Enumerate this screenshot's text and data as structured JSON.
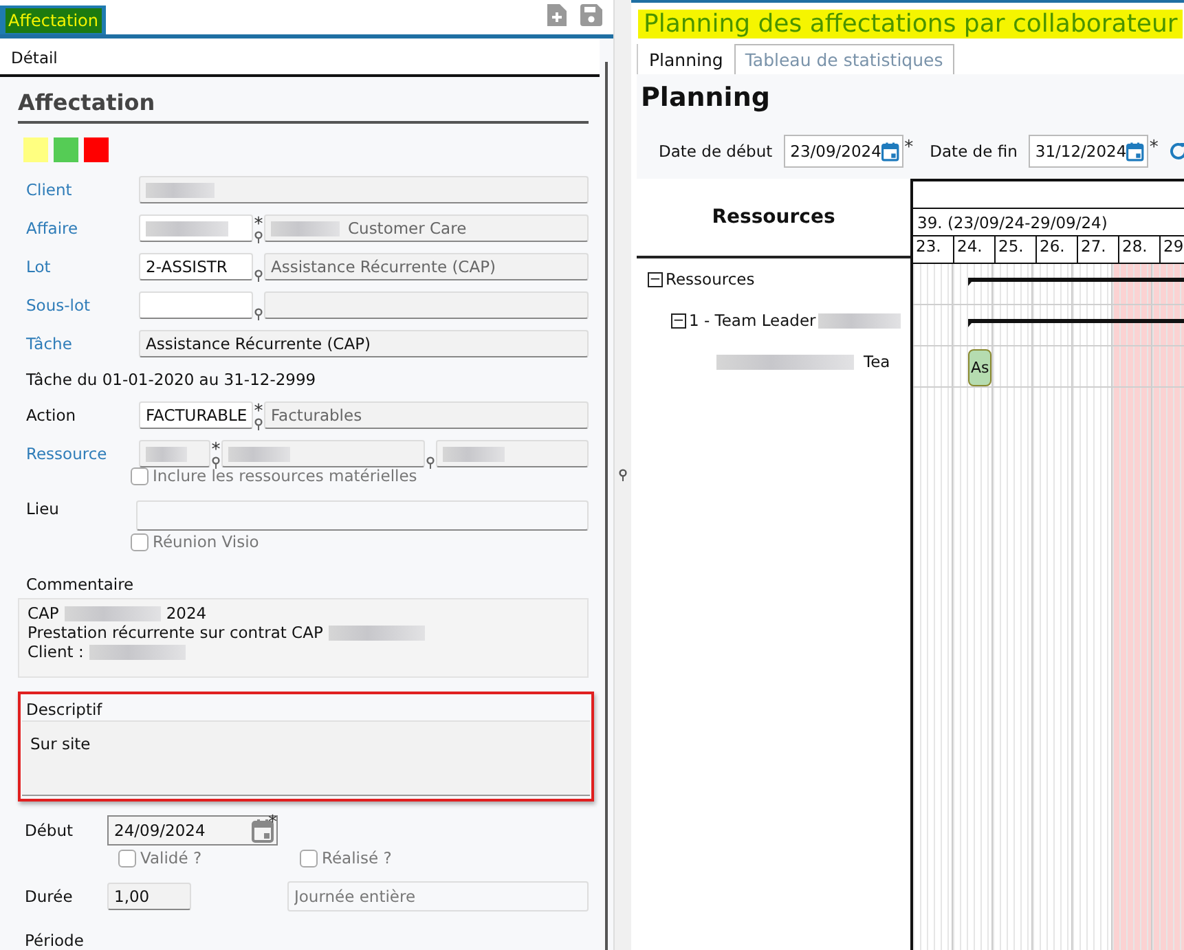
{
  "left_panel": {
    "tab": {
      "label": "Affectation",
      "selected": true
    },
    "section": "Détail",
    "heading": "Affectation",
    "swatches": [
      {
        "color": "#ffff80"
      },
      {
        "color": "#55cc55"
      },
      {
        "color": "#ff0000"
      }
    ],
    "fields": [
      {
        "kind": "lookup",
        "label": "Client",
        "link": true,
        "code_blurred": true
      },
      {
        "kind": "pair",
        "label": "Affaire",
        "link": true,
        "required": "*",
        "code_blurred": true,
        "desc_blurred": true,
        "desc": "Customer Care"
      },
      {
        "kind": "pair",
        "label": "Lot",
        "link": true,
        "code": "2-ASSISTR",
        "desc": "Assistance Récurrente (CAP)"
      },
      {
        "kind": "pair",
        "label": "Sous-lot",
        "link": true
      },
      {
        "kind": "full",
        "label": "Tâche",
        "link": true,
        "value": "Assistance Récurrente (CAP)"
      },
      {
        "kind": "note",
        "text": "Tâche du 01-01-2020 au 31-12-2999"
      },
      {
        "kind": "pair",
        "label": "Action",
        "link": false,
        "required": "*",
        "code": "FACTURABLE",
        "desc": "Facturables"
      },
      {
        "kind": "resource",
        "label": "Ressource",
        "link": true,
        "required": "*"
      },
      {
        "kind": "checkbox",
        "label": "Inclure les ressources matérielles",
        "checked": false
      },
      {
        "kind": "wide",
        "label": "Lieu",
        "link": false
      },
      {
        "kind": "checkbox",
        "label": "Réunion Visio",
        "checked": false
      }
    ],
    "comment": {
      "label": "Commentaire",
      "lines": [
        [
          {
            "kind": "text",
            "text": "CAP"
          },
          {
            "kind": "blur"
          },
          {
            "kind": "text",
            "text": "2024"
          }
        ],
        [
          {
            "kind": "text",
            "text": "Prestation récurrente sur contrat CAP"
          },
          {
            "kind": "blur"
          }
        ],
        [
          {
            "kind": "text",
            "text": "Client :"
          },
          {
            "kind": "blur"
          }
        ]
      ]
    },
    "description": {
      "label": "Descriptif",
      "value": "Sur site"
    },
    "start": {
      "label": "Début",
      "value": "24/09/2024",
      "required": "*"
    },
    "flags": [
      {
        "label": "Validé ?",
        "checked": false
      },
      {
        "label": "Réalisé ?",
        "checked": false
      }
    ],
    "duration": {
      "label": "Durée",
      "value": "1,00",
      "placeholder": "Journée entière"
    },
    "period_label": "Période"
  },
  "right_panel": {
    "title": "Planning des affectations par collaborateur",
    "tabs": [
      {
        "label": "Planning",
        "selected": true
      },
      {
        "label": "Tableau de statistiques",
        "selected": false
      }
    ],
    "heading": "Planning",
    "start_date": {
      "label": "Date de début",
      "value": "23/09/2024",
      "required": "*"
    },
    "end_date": {
      "label": "Date de fin",
      "value": "31/12/2024",
      "required": "*"
    },
    "gantt": {
      "resources_header": "Ressources",
      "week": "39. (23/09/24-29/09/24)",
      "days": [
        {
          "label": "23.",
          "weekend": false
        },
        {
          "label": "24.",
          "weekend": false,
          "bars_start": true
        },
        {
          "label": "25.",
          "weekend": false
        },
        {
          "label": "26.",
          "weekend": false
        },
        {
          "label": "27.",
          "weekend": false
        },
        {
          "label": "28.",
          "weekend": true
        },
        {
          "label": "29",
          "weekend": true
        }
      ],
      "tree": [
        {
          "label": "Ressources",
          "toggle": "−",
          "expanded": true,
          "bar": {
            "kind": "summary"
          },
          "children": [
            {
              "label": "1 - Team Leader",
              "blurred_suffix": true,
              "toggle": "−",
              "expanded": true,
              "bar": {
                "kind": "summary"
              },
              "children": [
                {
                  "label": "Tea",
                  "blurred_prefix": true,
                  "bar": {
                    "kind": "task",
                    "text": "As"
                  }
                }
              ]
            }
          ]
        }
      ]
    }
  }
}
